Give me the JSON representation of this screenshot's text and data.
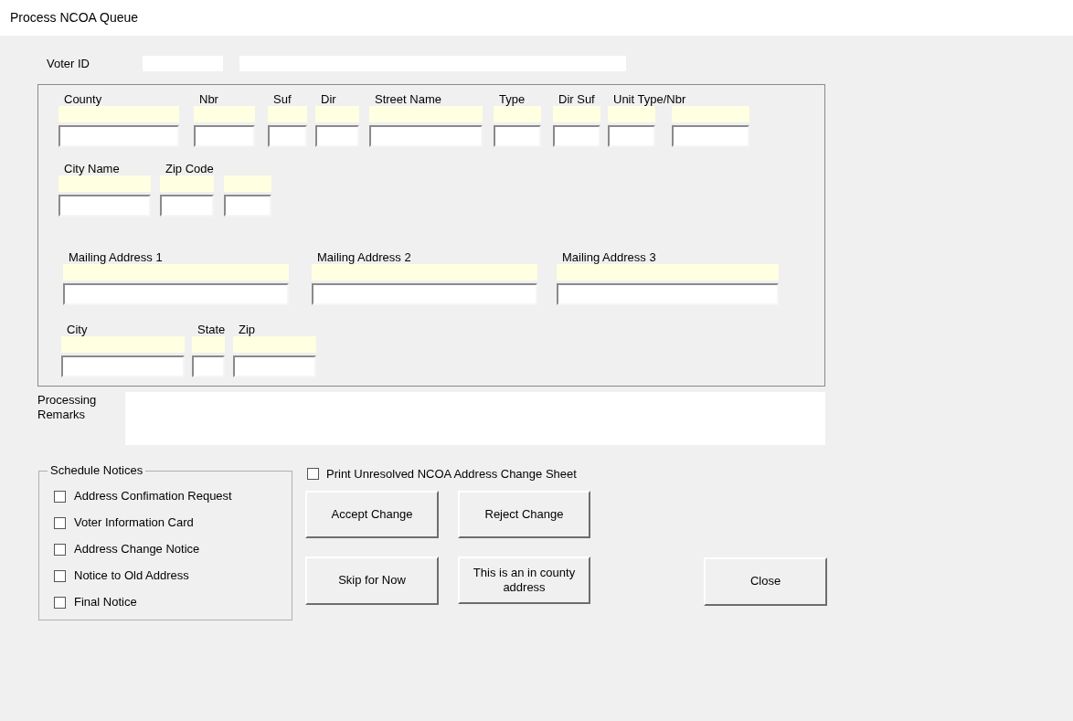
{
  "window": {
    "title": "Process NCOA Queue"
  },
  "voter_id": {
    "label": "Voter ID"
  },
  "address_rows": [
    {
      "fields": [
        {
          "label": "County"
        },
        {
          "label": "Nbr"
        },
        {
          "label": "Suf"
        },
        {
          "label": "Dir"
        },
        {
          "label": "Street Name"
        },
        {
          "label": "Type"
        },
        {
          "label": "Dir Suf"
        },
        {
          "label": "Unit Type/Nbr"
        }
      ]
    },
    {
      "fields": [
        {
          "label": "City Name"
        },
        {
          "label": "Zip Code"
        }
      ]
    },
    {
      "fields": [
        {
          "label": "Mailing Address 1"
        },
        {
          "label": "Mailing Address 2"
        },
        {
          "label": "Mailing Address 3"
        }
      ]
    },
    {
      "fields": [
        {
          "label": "City"
        },
        {
          "label": "State"
        },
        {
          "label": "Zip"
        }
      ]
    }
  ],
  "processing_remarks": {
    "label": "Processing Remarks"
  },
  "schedule_notices": {
    "title": "Schedule Notices",
    "items": [
      {
        "label": "Address Confimation Request",
        "checked": false
      },
      {
        "label": "Voter Information Card",
        "checked": false
      },
      {
        "label": "Address Change Notice",
        "checked": false
      },
      {
        "label": "Notice to Old Address",
        "checked": false
      },
      {
        "label": "Final Notice",
        "checked": false
      }
    ]
  },
  "print_sheet": {
    "label": "Print Unresolved NCOA Address Change Sheet",
    "checked": false
  },
  "buttons": [
    {
      "label": "Accept Change"
    },
    {
      "label": "Reject Change"
    },
    {
      "label": "Skip for Now"
    },
    {
      "label": "This is an in county address"
    },
    {
      "label": "Close"
    }
  ]
}
